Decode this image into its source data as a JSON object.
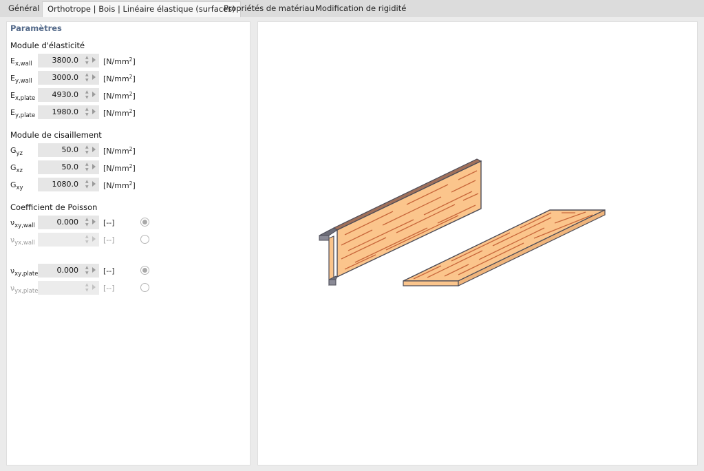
{
  "tabs": [
    {
      "label": "Général"
    },
    {
      "label": "Orthotrope | Bois | Linéaire élastique (surfaces)"
    },
    {
      "label": "Propriétés de matériau"
    },
    {
      "label": "Modification de rigidité"
    }
  ],
  "section_title": "Paramètres",
  "elasticity": {
    "label": "Module d'élasticité",
    "rows": [
      {
        "sym": "E",
        "sub": "x,wall",
        "value": "3800.0",
        "unit": "[N/mm",
        "unit_exp": "2",
        "unit_end": "]"
      },
      {
        "sym": "E",
        "sub": "y,wall",
        "value": "3000.0",
        "unit": "[N/mm",
        "unit_exp": "2",
        "unit_end": "]"
      },
      {
        "sym": "E",
        "sub": "x,plate",
        "value": "4930.0",
        "unit": "[N/mm",
        "unit_exp": "2",
        "unit_end": "]"
      },
      {
        "sym": "E",
        "sub": "y,plate",
        "value": "1980.0",
        "unit": "[N/mm",
        "unit_exp": "2",
        "unit_end": "]"
      }
    ]
  },
  "shear": {
    "label": "Module de cisaillement",
    "rows": [
      {
        "sym": "G",
        "sub": "yz",
        "value": "50.0",
        "unit": "[N/mm",
        "unit_exp": "2",
        "unit_end": "]"
      },
      {
        "sym": "G",
        "sub": "xz",
        "value": "50.0",
        "unit": "[N/mm",
        "unit_exp": "2",
        "unit_end": "]"
      },
      {
        "sym": "G",
        "sub": "xy",
        "value": "1080.0",
        "unit": "[N/mm",
        "unit_exp": "2",
        "unit_end": "]"
      }
    ]
  },
  "poisson": {
    "label": "Coefficient de Poisson",
    "rows": [
      {
        "sym": "ν",
        "sub": "xy,wall",
        "value": "0.000",
        "unit": "[--]",
        "selected": true
      },
      {
        "sym": "ν",
        "sub": "yx,wall",
        "value": "",
        "unit": "[--]",
        "selected": false
      },
      {
        "sym": "ν",
        "sub": "xy,plate",
        "value": "0.000",
        "unit": "[--]",
        "selected": true
      },
      {
        "sym": "ν",
        "sub": "yx,plate",
        "value": "",
        "unit": "[--]",
        "selected": false
      }
    ]
  },
  "colors": {
    "wood": "#fbc58c",
    "wood_line": "#c8673b",
    "outline": "#4c4c57",
    "steel": "#8a8a96",
    "accent_title": "#546a8a"
  }
}
